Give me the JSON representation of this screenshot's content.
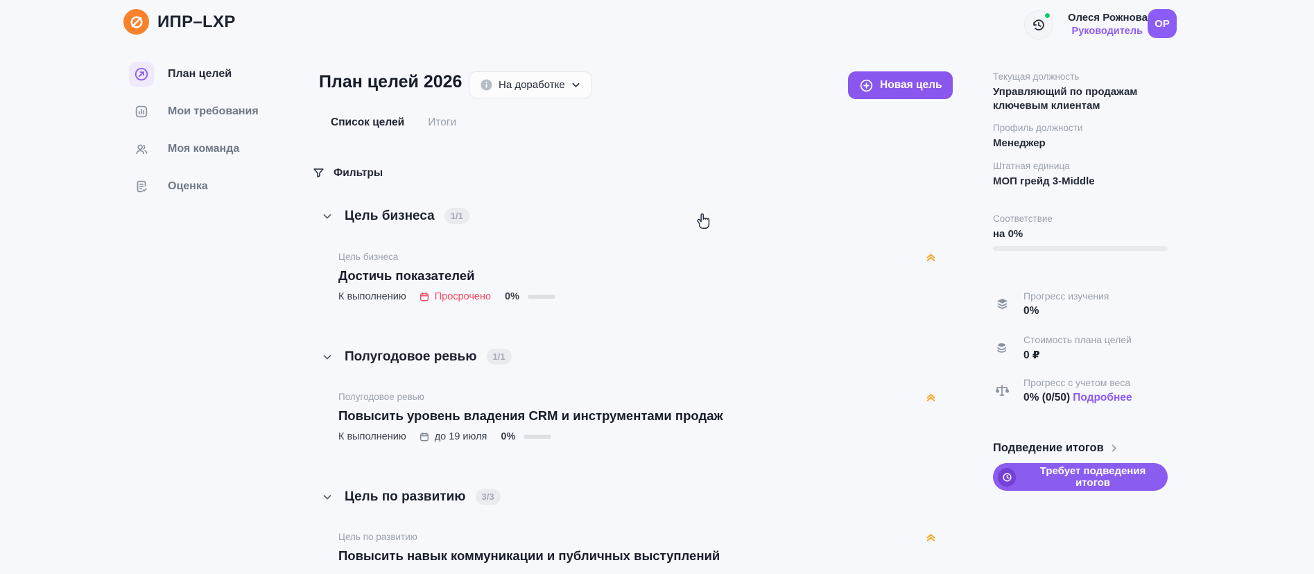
{
  "app": {
    "title": "ИПР–LXP"
  },
  "topbar": {
    "user": {
      "name": "Олеся Рожнова",
      "role": "Руководитель",
      "initials": "ОР"
    }
  },
  "sidebar": {
    "items": [
      {
        "label": "План целей",
        "active": true
      },
      {
        "label": "Мои требования",
        "active": false
      },
      {
        "label": "Моя команда",
        "active": false
      },
      {
        "label": "Оценка",
        "active": false
      }
    ]
  },
  "main": {
    "page_title": "План целей 2026",
    "status_label": "На доработке",
    "new_goal_label": "Новая цель",
    "tabs": [
      {
        "label": "Список целей",
        "active": true
      },
      {
        "label": "Итоги",
        "active": false
      }
    ],
    "filters_label": "Фильтры",
    "sections": [
      {
        "title": "Цель бизнеса",
        "count": "1/1",
        "goal": {
          "category": "Цель бизнеса",
          "title": "Достичь показателей",
          "status": "К выполнению",
          "due": "Просрочено",
          "overdue": true,
          "progress": "0%"
        }
      },
      {
        "title": "Полугодовое ревью",
        "count": "1/1",
        "goal": {
          "category": "Полугодовое ревью",
          "title": "Повысить уровень владения CRM и инструментами продаж",
          "status": "К выполнению",
          "due": "до 19 июля",
          "overdue": false,
          "progress": "0%"
        }
      },
      {
        "title": "Цель по развитию",
        "count": "3/3",
        "goal": {
          "category": "Цель по развитию",
          "title": "Повысить навык коммуникации и публичных выступлений"
        }
      }
    ]
  },
  "profile": {
    "fields": [
      {
        "label": "Текущая должность",
        "value": "Управляющий по продажам ключевым клиентам"
      },
      {
        "label": "Профиль должности",
        "value": "Менеджер"
      },
      {
        "label": "Штатная единица",
        "value": "МОП грейд 3-Middle"
      }
    ],
    "match": {
      "label": "Соответствие",
      "value": "на 0%",
      "percent": 0
    },
    "stats": [
      {
        "icon": "layers-icon",
        "label": "Прогресс изучения",
        "value": "0%"
      },
      {
        "icon": "coins-icon",
        "label": "Стоимость плана целей",
        "value": "0 ₽"
      },
      {
        "icon": "scales-icon",
        "label": "Прогресс с учетом веса",
        "value": "0% (0/50)",
        "link": "Подробнее"
      }
    ],
    "summary": {
      "title": "Подведение итогов",
      "badge": "Требует подведения итогов"
    }
  },
  "colors": {
    "accent_purple": "#8b5cf6",
    "overdue_red": "#f3455c",
    "logo_orange": "#f8822b",
    "priority_amber": "#f6a724",
    "online_green": "#17c964",
    "background": "#f7f8fb"
  }
}
